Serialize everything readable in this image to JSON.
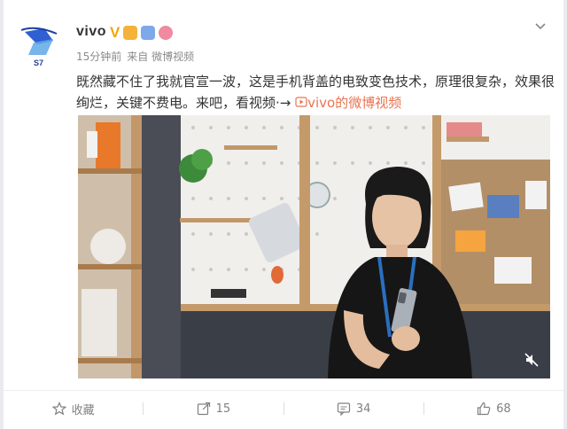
{
  "post": {
    "author": "vivo",
    "verified_mark": "V",
    "timestamp": "15分钟前",
    "source": "来自 微博视频",
    "text_main": "既然藏不住了我就官宣一波，这是手机背盖的电致变色技术，原理很复杂，效果很绚烂，关键不费电。来吧，看视频",
    "text_arrow": "·→",
    "video_link": "vivo的微博视频",
    "avatar_text": "S7"
  },
  "actions": [
    {
      "label": "收藏",
      "icon": "star-icon"
    },
    {
      "label": "15",
      "icon": "share-icon"
    },
    {
      "label": "34",
      "icon": "comment-icon"
    },
    {
      "label": "68",
      "icon": "like-icon"
    }
  ],
  "colors": {
    "accent": "#eb7350",
    "verified": "#f7a400",
    "brand_blue": "#2f5fd2"
  }
}
